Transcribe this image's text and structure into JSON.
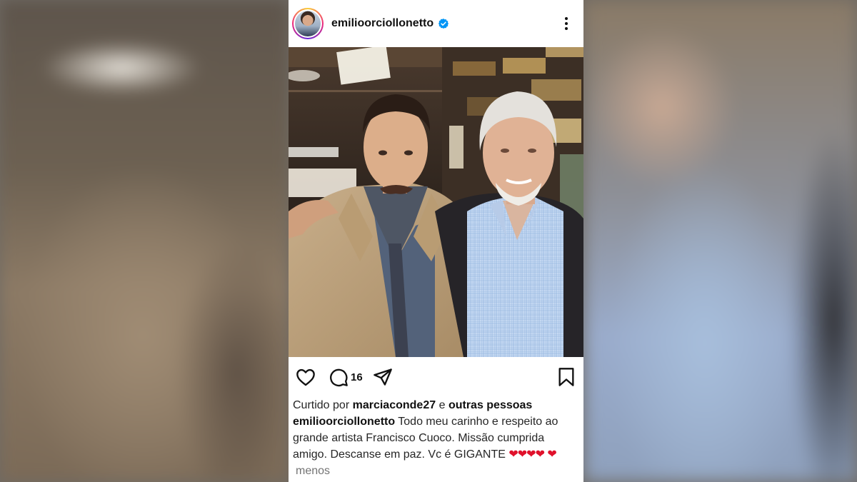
{
  "post": {
    "username": "emilioorciollonetto",
    "verified": true,
    "comment_count": "16",
    "liked_prefix": "Curtido por",
    "liked_user": "marciaconde27",
    "liked_conj": "e",
    "liked_others": "outras pessoas",
    "caption_user": "emilioorciollonetto",
    "caption_text": "Todo meu carinho e respeito ao grande artista Francisco Cuoco. Missão cumprida amigo. Descanse em paz. Vc é GIGANTE",
    "caption_emoji_row1": "❤❤❤❤",
    "caption_emoji_row2": "❤",
    "less_label": "menos"
  },
  "icons": {
    "verified": "verified-badge-icon",
    "more": "more-options-icon",
    "like": "heart-icon",
    "comment": "comment-icon",
    "share": "send-icon",
    "save": "bookmark-icon"
  },
  "colors": {
    "verified_blue": "#0095f6",
    "heart_red": "#e0112b",
    "text_dark": "#262626",
    "text_muted": "#737373"
  }
}
